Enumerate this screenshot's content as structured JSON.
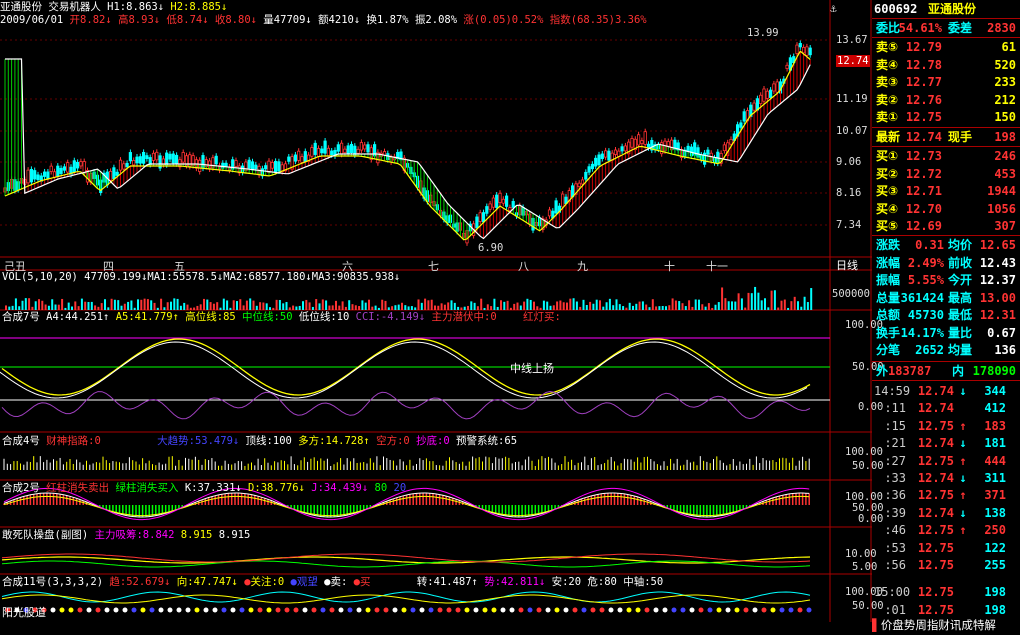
{
  "header": {
    "name": "亚通股份",
    "indicator": "交易机器人",
    "h1": "H1:8.863↓",
    "h2": "H2:8.885↓",
    "date": "2009/06/01",
    "open": "开8.82↓",
    "high": "高8.93↓",
    "low": "低8.74↓",
    "close": "收8.80↓",
    "volume": "量47709↓",
    "amount": "额4210↓",
    "turnover": "换1.87%",
    "amplitude": "振2.08%",
    "change": "涨(0.05)0.52%",
    "index": "指数(68.35)3.36%"
  },
  "price_axis": [
    "13.67",
    "12.74",
    "11.19",
    "10.07",
    "9.06",
    "8.16",
    "7.34"
  ],
  "price_marks": {
    "high": "13.99",
    "low": "6.90"
  },
  "date_axis": [
    "己丑",
    "四",
    "五",
    "六",
    "七",
    "八",
    "九",
    "十",
    "十一"
  ],
  "period_btn": "日线",
  "vol": {
    "title": "VOL(5,10,20) 47709.199↓MA1:55578.5↓MA2:68577.180↓MA3:90835.938↓",
    "axis": "500000",
    "colors": {
      "up": "#ff3333",
      "down": "#00ffff"
    }
  },
  "ind1": {
    "name": "合成7号",
    "a4": "A4:44.251↑",
    "a5": "A5:41.779↑",
    "hi": "高位线:85",
    "mid": "中位线:50",
    "lo": "低位线:10",
    "cci": "CCI:-4.149↓",
    "zl": "主力潜伏中:0",
    "hd": "红灯买:",
    "label_up": "中线上扬",
    "axis": [
      "100.00",
      "50.00",
      "0.00"
    ]
  },
  "ind2": {
    "name": "合成4号",
    "cs": "财神指路:0",
    "dq": "大趋势:53.479↓",
    "dx": "顶线:100",
    "df": "多方:14.728↑",
    "kf": "空方:0",
    "cd": "抄底:0",
    "yj": "预警系统:65",
    "axis": [
      "100.00",
      "50.00"
    ]
  },
  "ind3": {
    "name": "合成2号",
    "hz": "红柱消失卖出",
    "lz": "绿柱消失买入",
    "k": "K:37.331↓",
    "d": "D:38.776↓",
    "j": "J:34.439↓",
    "n80": "80",
    "n20": "20",
    "axis": [
      "100.00",
      "50.00",
      "0.00"
    ]
  },
  "ind4": {
    "name": "敢死队操盘(副图)",
    "zl": "主力吸筹:8.842",
    "v2": "8.915",
    "v3": "8.915",
    "axis": [
      "10.00",
      "5.00"
    ]
  },
  "ind5": {
    "name": "合成11号(3,3,3,2)",
    "q": "趋:52.679↓",
    "x": "向:47.747↓",
    "gz": "关注:0",
    "kd": "观望",
    "m": "卖:",
    "b": "买",
    "zh": "转:41.487↑",
    "s": "势:42.811↓",
    "a": "安:20",
    "w": "危:80",
    "zz": "中轴:50",
    "axis": [
      "100.00",
      "50.00"
    ]
  },
  "bottom_label": "阳光股道",
  "quote": {
    "code": "600692",
    "name": "亚通股份",
    "wb_lab": "委比",
    "wb": "54.61%",
    "wc_lab": "委差",
    "wc": "2830",
    "sell": [
      {
        "lab": "卖⑤",
        "p": "12.79",
        "v": "61"
      },
      {
        "lab": "卖④",
        "p": "12.78",
        "v": "520"
      },
      {
        "lab": "卖③",
        "p": "12.77",
        "v": "233"
      },
      {
        "lab": "卖②",
        "p": "12.76",
        "v": "212"
      },
      {
        "lab": "卖①",
        "p": "12.75",
        "v": "150"
      }
    ],
    "last_lab": "最新",
    "last": "12.74",
    "hand_lab": "现手",
    "hand": "198",
    "buy": [
      {
        "lab": "买①",
        "p": "12.73",
        "v": "246"
      },
      {
        "lab": "买②",
        "p": "12.72",
        "v": "453"
      },
      {
        "lab": "买③",
        "p": "12.71",
        "v": "1944"
      },
      {
        "lab": "买④",
        "p": "12.70",
        "v": "1056"
      },
      {
        "lab": "买⑤",
        "p": "12.69",
        "v": "307"
      }
    ],
    "stats": [
      {
        "l1": "涨跌",
        "v1": "0.31",
        "l2": "均价",
        "v2": "12.65"
      },
      {
        "l1": "涨幅",
        "v1": "2.49%",
        "l2": "前收",
        "v2": "12.43"
      },
      {
        "l1": "振幅",
        "v1": "5.55%",
        "l2": "今开",
        "v2": "12.37"
      },
      {
        "l1": "总量",
        "v1": "361424",
        "l2": "最高",
        "v2": "13.00"
      },
      {
        "l1": "总额",
        "v1": "45730",
        "l2": "最低",
        "v2": "12.31"
      },
      {
        "l1": "换手",
        "v1": "14.17%",
        "l2": "量比",
        "v2": "0.67"
      },
      {
        "l1": "分笔",
        "v1": "2652",
        "l2": "均量",
        "v2": "136"
      }
    ],
    "outer_lab": "外",
    "outer": "183787",
    "inner_lab": "内",
    "inner": "178090"
  },
  "ticks": [
    {
      "t": "14:59",
      "p": "12.74",
      "a": "↓",
      "v": "344"
    },
    {
      "t": ":11",
      "p": "12.74",
      "a": "",
      "v": "412"
    },
    {
      "t": ":15",
      "p": "12.75",
      "a": "↑",
      "v": "183"
    },
    {
      "t": ":21",
      "p": "12.74",
      "a": "↓",
      "v": "181"
    },
    {
      "t": ":27",
      "p": "12.75",
      "a": "↑",
      "v": "444"
    },
    {
      "t": ":33",
      "p": "12.74",
      "a": "↓",
      "v": "311"
    },
    {
      "t": ":36",
      "p": "12.75",
      "a": "↑",
      "v": "371"
    },
    {
      "t": ":39",
      "p": "12.74",
      "a": "↓",
      "v": "138"
    },
    {
      "t": ":46",
      "p": "12.75",
      "a": "↑",
      "v": "250"
    },
    {
      "t": ":53",
      "p": "12.75",
      "a": "",
      "v": "122"
    },
    {
      "t": ":56",
      "p": "12.75",
      "a": "",
      "v": "255"
    },
    {
      "t": "15:00",
      "p": "12.75",
      "a": "",
      "v": "198"
    },
    {
      "t": ":01",
      "p": "12.75",
      "a": "",
      "v": "198"
    }
  ],
  "bottom_tabs": "价盘势周指财讯成特解",
  "colors": {
    "red": "#ff3030",
    "green": "#00e000",
    "cyan": "#00ffff",
    "yellow": "#ffff00",
    "white": "#ffffff",
    "magenta": "#ff40ff",
    "blue": "#4080ff"
  }
}
